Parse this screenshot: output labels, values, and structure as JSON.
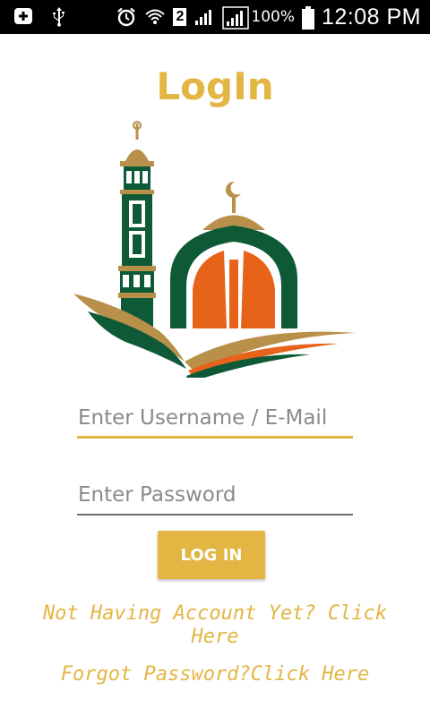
{
  "status_bar": {
    "icons_left": [
      "add-box-icon",
      "usb-icon"
    ],
    "icons_right": [
      "alarm-icon",
      "wifi-icon",
      "sim-icon",
      "signal-icon",
      "signal-icon",
      "battery-icon"
    ],
    "sim_number": "2",
    "battery": "100%",
    "time": "12:08 PM"
  },
  "page": {
    "title": "LogIn"
  },
  "logo": {
    "colors": {
      "gold": "#B8904A",
      "green": "#0E5A37",
      "orange": "#E8631A"
    }
  },
  "form": {
    "username_placeholder": "Enter Username / E-Mail",
    "password_placeholder": "Enter Password",
    "login_label": "LOG IN"
  },
  "links": {
    "signup": "Not Having Account Yet? Click Here",
    "forgot": "Forgot Password?Click Here"
  },
  "colors": {
    "accent": "#E3B543",
    "status_bar": "#000000"
  }
}
